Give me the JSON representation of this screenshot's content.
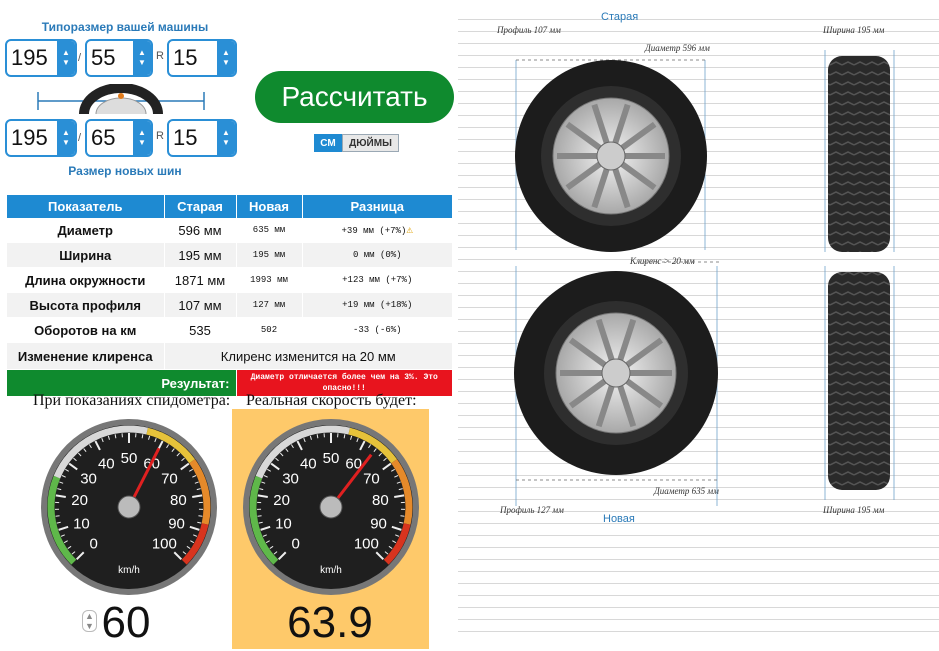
{
  "inputs": {
    "caption_old": "Типоразмер вашей машины",
    "caption_new": "Размер новых шин",
    "old": {
      "width": "195",
      "profile": "55",
      "r": "R",
      "diameter": "15"
    },
    "new": {
      "width": "195",
      "profile": "65",
      "r": "R",
      "diameter": "15"
    },
    "slash": "/"
  },
  "calculate_label": "Рассчитать",
  "units": {
    "cm": "СМ",
    "inches": "ДЮЙМЫ",
    "active": "cm"
  },
  "table": {
    "headers": [
      "Показатель",
      "Старая",
      "Новая",
      "Разница"
    ],
    "rows": [
      {
        "label": "Диаметр",
        "old": "596 мм",
        "new": "635 мм",
        "diff": "+39 мм (+7%)",
        "warn": true
      },
      {
        "label": "Ширина",
        "old": "195 мм",
        "new": "195 мм",
        "diff": "0 мм (0%)",
        "warn": false
      },
      {
        "label": "Длина окружности",
        "old": "1871 мм",
        "new": "1993 мм",
        "diff": "+123 мм (+7%)",
        "warn": false
      },
      {
        "label": "Высота профиля",
        "old": "107 мм",
        "new": "127 мм",
        "diff": "+19 мм (+18%)",
        "warn": false
      },
      {
        "label": "Оборотов на км",
        "old": "535",
        "new": "502",
        "diff": "-33 (-6%)",
        "warn": false
      }
    ],
    "clearance_label": "Изменение клиренса",
    "clearance_value": "Клиренс изменится на 20 мм",
    "result_label": "Результат:",
    "result_text": "Диаметр отличается более чем на 3%. Это опасно!!!"
  },
  "speed": {
    "title_shown": "При показаниях спидометра:",
    "title_real": "Реальная скорость будет:",
    "shown_value": "60",
    "real_value": "63.9",
    "unit": "km/h",
    "ticks": [
      "0",
      "10",
      "20",
      "30",
      "40",
      "50",
      "60",
      "70",
      "80",
      "90",
      "100"
    ]
  },
  "diagram": {
    "old_title": "Старая",
    "new_title": "Новая",
    "old_profile": "Профиль 107 мм",
    "old_width": "Ширина 195 мм",
    "old_diameter": "Диаметр 596 мм",
    "clearance": "Клиренс > 20 мм",
    "new_diameter": "Диаметр 635 мм",
    "new_profile": "Профиль 127 мм",
    "new_width": "Ширина 195 мм"
  },
  "colors": {
    "accent": "#1e8ad2",
    "go": "#0f8a2e",
    "danger": "#e8141e",
    "highlight": "#fec96a"
  }
}
